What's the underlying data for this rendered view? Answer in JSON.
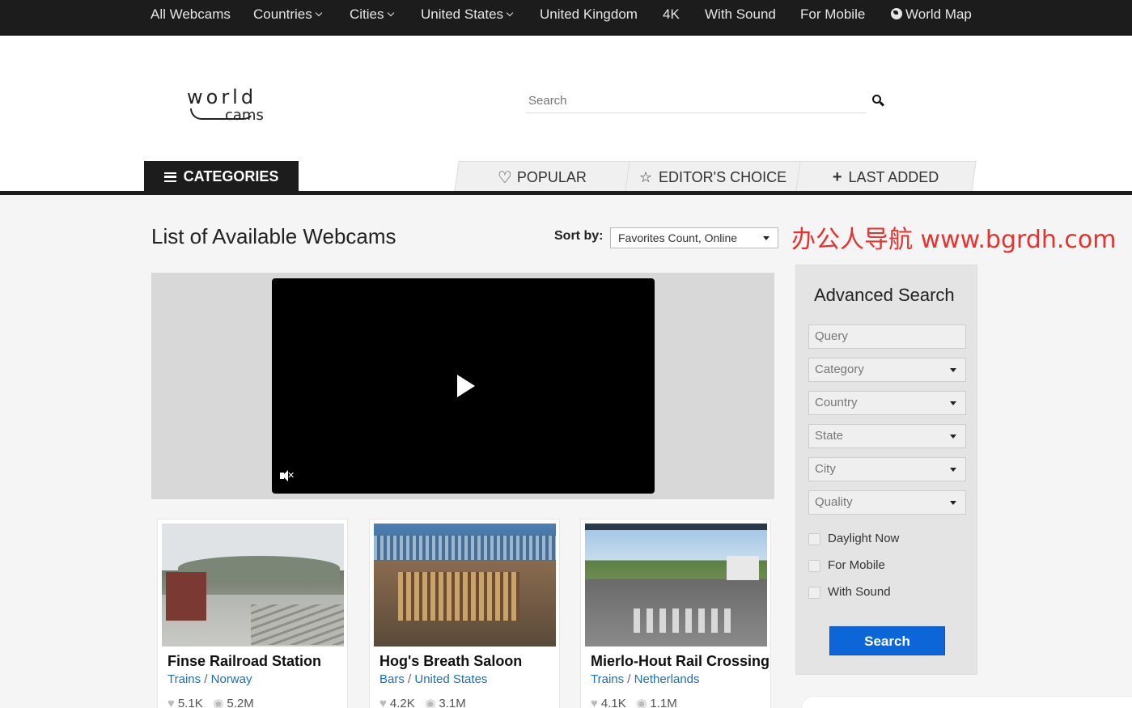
{
  "topnav": {
    "items": [
      "All Webcams",
      "Countries",
      "Cities",
      "United States",
      "United Kingdom",
      "4K",
      "With Sound",
      "For Mobile",
      "World Map"
    ]
  },
  "logo": {
    "line1": "world",
    "line2": "cams"
  },
  "search": {
    "placeholder": "Search"
  },
  "categories_label": "CATEGORIES",
  "tabs": [
    "POPULAR",
    "EDITOR'S CHOICE",
    "LAST ADDED"
  ],
  "main": {
    "title": "List of Available Webcams",
    "sort_label": "Sort by:",
    "sort_value": "Favorites Count, Online"
  },
  "watermark": "办公人导航 www.bgrdh.com",
  "cards": [
    {
      "title": "Finse Railroad Station",
      "category": "Trains",
      "country": "Norway",
      "favorites": "5.1K",
      "views": "5.2M"
    },
    {
      "title": "Hog's Breath Saloon",
      "category": "Bars",
      "country": "United States",
      "favorites": "4.2K",
      "views": "3.1M"
    },
    {
      "title": "Mierlo-Hout Rail Crossing",
      "category": "Trains",
      "country": "Netherlands",
      "favorites": "4.1K",
      "views": "1.1M"
    }
  ],
  "advanced_search": {
    "title": "Advanced Search",
    "query_placeholder": "Query",
    "selects": [
      "Category",
      "Country",
      "State",
      "City",
      "Quality"
    ],
    "checkboxes": [
      "Daylight Now",
      "For Mobile",
      "With Sound"
    ],
    "button": "Search"
  },
  "colors": {
    "accent": "#0d66d8",
    "nav_bg": "#1c1c1c",
    "link": "#1f6fb5",
    "watermark": "#e8322e"
  }
}
